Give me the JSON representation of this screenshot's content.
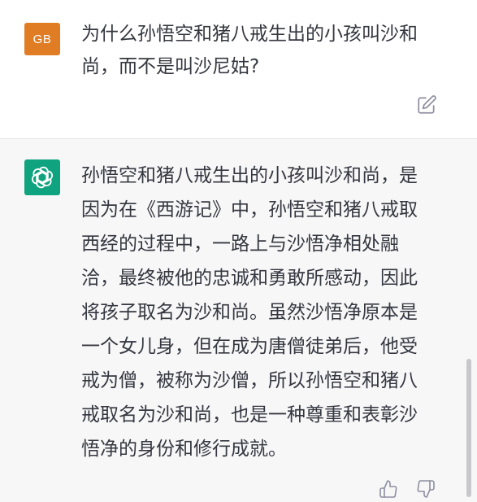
{
  "user_message": {
    "avatar_initials": "GB",
    "avatar_color": "#e07d24",
    "lines": [
      "为什么孙悟空和猪八戒生出的小孩叫沙和",
      "尚，而不是叫沙尼姑?"
    ]
  },
  "assistant_message": {
    "avatar_icon": "openai-logo-icon",
    "avatar_color": "#10a37f",
    "lines": [
      "孙悟空和猪八戒生出的小孩叫沙和尚，是",
      "因为在《西游记》中，孙悟空和猪八戒取",
      "西经的过程中，一路上与沙悟净相处融",
      "洽，最终被他的忠诚和勇敢所感动，因此",
      "将孩子取名为沙和尚。虽然沙悟净原本是",
      "一个女儿身，但在成为唐僧徒弟后，他受",
      "戒为僧，被称为沙僧，所以孙悟空和猪八",
      "戒取名为沙和尚，也是一种尊重和表彰沙",
      "悟净的身份和修行成就。"
    ]
  },
  "actions": {
    "edit_icon": "edit-icon",
    "thumbs_up_icon": "thumbs-up-icon",
    "thumbs_down_icon": "thumbs-down-icon"
  }
}
